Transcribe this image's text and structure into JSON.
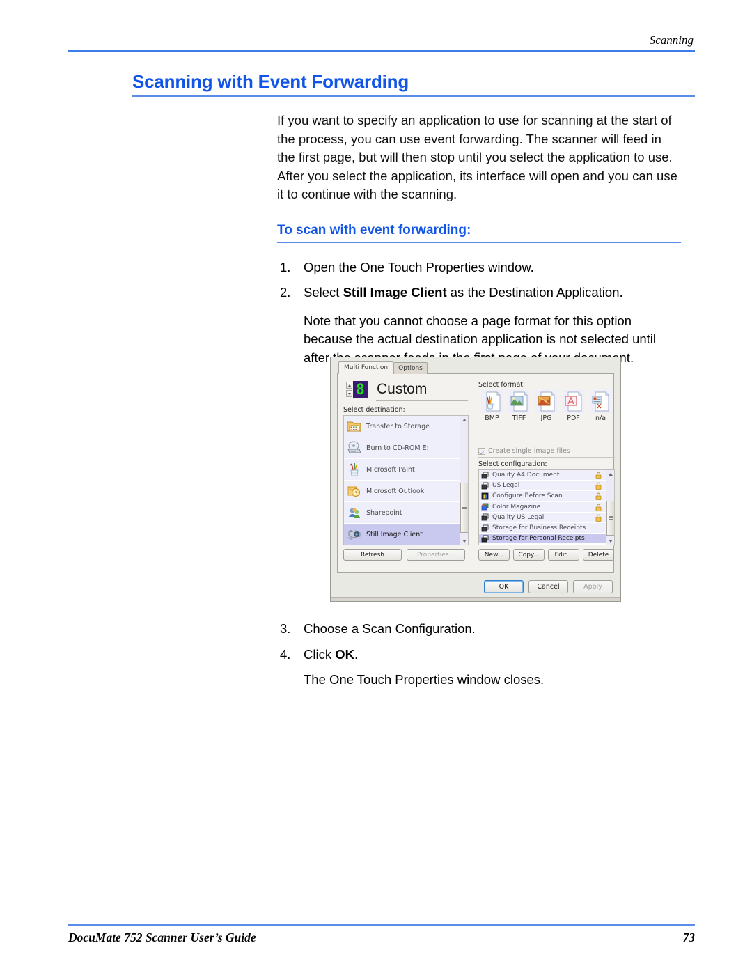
{
  "page": {
    "running_head": "Scanning",
    "title": "Scanning with Event Forwarding",
    "intro": "If you want to specify an application to use for scanning at the start of the process, you can use event forwarding. The scanner will feed in the first page, but will then stop until you select the application to use. After you select the application, its interface will open and you can use it to continue with the scanning.",
    "subtitle": "To scan with event forwarding:",
    "steps": [
      {
        "num": "1.",
        "text_before": "Open the One Touch Properties window.",
        "bold": "",
        "text_after": ""
      },
      {
        "num": "2.",
        "text_before": "Select ",
        "bold": "Still Image Client",
        "text_after": " as the Destination Application."
      }
    ],
    "note": "Note that you cannot choose a page format for this option because the actual destination application is not selected until after the scanner feeds in the first page of your document.",
    "steps_after": [
      {
        "num": "3.",
        "text_before": "Choose a Scan Configuration.",
        "bold": "",
        "text_after": ""
      },
      {
        "num": "4.",
        "text_before": "Click ",
        "bold": "OK",
        "text_after": "."
      }
    ],
    "closing": "The One Touch Properties window closes.",
    "footer_left": "DocuMate 752 Scanner User’s Guide",
    "footer_right": "73",
    "accent_color": "#1155e8",
    "rule_color": "#3d7ce8"
  },
  "dialog": {
    "tabs": [
      {
        "label": "Multi Function",
        "active": true
      },
      {
        "label": "Options",
        "active": false
      }
    ],
    "led_digit": "8",
    "function_name": "Custom",
    "destination_label": "Select destination:",
    "destinations": [
      {
        "label": "Transfer to Storage",
        "icon": "folder-storage-icon",
        "selected": false
      },
      {
        "label": "Burn to CD-ROM  E:",
        "icon": "cd-burner-icon",
        "selected": false
      },
      {
        "label": "Microsoft Paint",
        "icon": "paint-icon",
        "selected": false
      },
      {
        "label": "Microsoft Outlook",
        "icon": "outlook-icon",
        "selected": false
      },
      {
        "label": "Sharepoint",
        "icon": "sharepoint-icon",
        "selected": false
      },
      {
        "label": "Still Image Client",
        "icon": "camera-icon",
        "selected": true
      }
    ],
    "format_label": "Select format:",
    "formats": [
      {
        "label": "BMP",
        "icon": "bmp-format-icon"
      },
      {
        "label": "TIFF",
        "icon": "tiff-format-icon"
      },
      {
        "label": "JPG",
        "icon": "jpg-format-icon"
      },
      {
        "label": "PDF",
        "icon": "pdf-format-icon"
      },
      {
        "label": "n/a",
        "icon": "text-format-icon"
      }
    ],
    "single_image_label": "Create single image files",
    "single_image_checked": true,
    "configuration_label": "Select configuration:",
    "configurations": [
      {
        "label": "Quality A4 Document",
        "locked": true,
        "selected": false,
        "icon": "config-icon"
      },
      {
        "label": "US Legal",
        "locked": true,
        "selected": false,
        "icon": "config-icon"
      },
      {
        "label": "Configure Before Scan",
        "locked": true,
        "selected": false,
        "icon": "color-bars-icon"
      },
      {
        "label": "Color Magazine",
        "locked": true,
        "selected": false,
        "icon": "color-config-icon"
      },
      {
        "label": "Quality US Legal",
        "locked": true,
        "selected": false,
        "icon": "config-icon"
      },
      {
        "label": "Storage for Business Receipts",
        "locked": false,
        "selected": false,
        "icon": "config-icon"
      },
      {
        "label": "Storage for Personal Receipts",
        "locked": false,
        "selected": true,
        "icon": "config-icon"
      }
    ],
    "buttons": {
      "refresh": "Refresh",
      "properties": "Properties...",
      "new": "New...",
      "copy": "Copy...",
      "edit": "Edit...",
      "delete": "Delete",
      "ok": "OK",
      "cancel": "Cancel",
      "apply": "Apply"
    },
    "selection_color": "#c9c8ee",
    "led_background": "#3a1a6e",
    "led_color": "#19e019"
  }
}
